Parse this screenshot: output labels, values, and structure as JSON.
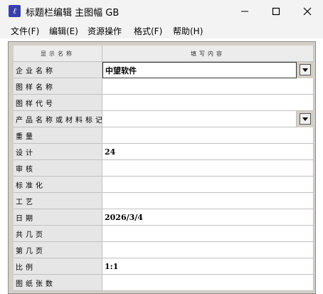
{
  "window": {
    "title": "标题栏编辑 主图幅 GB",
    "icon": "app-logo-icon",
    "icon_glyph": "ℓ",
    "controls": [
      "minimize-icon",
      "maximize-icon",
      "close-icon"
    ]
  },
  "menu": [
    {
      "label": "文件(F)"
    },
    {
      "label": "编辑(E)"
    },
    {
      "label": "资源操作"
    },
    {
      "label": "格式(F)"
    },
    {
      "label": "帮助(H)"
    }
  ],
  "grid": {
    "header": {
      "name_col": "显示名称",
      "value_col": "填写内容"
    },
    "rows": [
      {
        "label": "企业名称",
        "value": "中望软件",
        "dropdown": true,
        "selected": true
      },
      {
        "label": "图样名称",
        "value": ""
      },
      {
        "label": "图样代号",
        "value": ""
      },
      {
        "label": "产品名称或材料标记",
        "value": "",
        "dropdown": true
      },
      {
        "label": "重量",
        "value": ""
      },
      {
        "label": "设计",
        "value": "24"
      },
      {
        "label": "审核",
        "value": ""
      },
      {
        "label": "标准化",
        "value": ""
      },
      {
        "label": "工艺",
        "value": ""
      },
      {
        "label": "日期",
        "value": "2026/3/4"
      },
      {
        "label": "共几页",
        "value": ""
      },
      {
        "label": "第几页",
        "value": ""
      },
      {
        "label": "比例",
        "value": "1:1"
      },
      {
        "label": "图纸张数",
        "value": ""
      }
    ]
  },
  "colors": {
    "titlebar": "#f3f3f3",
    "grid_frame": "#d4d0c8",
    "label_cell": "#e6e6e6",
    "app_icon": "#3a3fb0"
  }
}
